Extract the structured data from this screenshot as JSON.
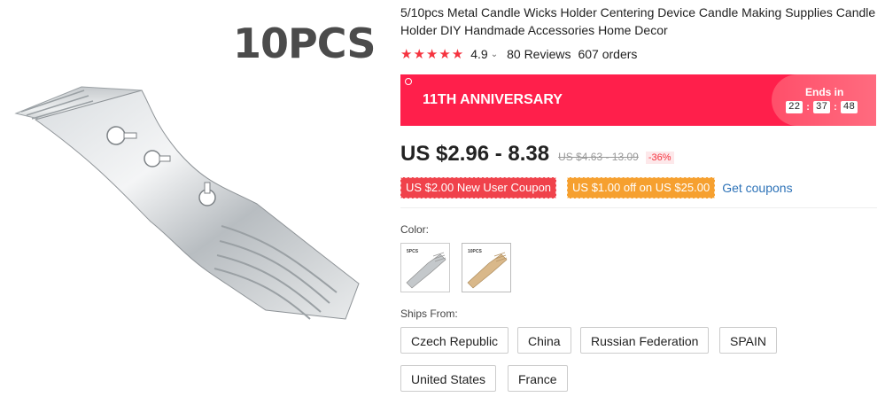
{
  "image_label": "10PCS",
  "product": {
    "title": "5/10pcs Metal Candle Wicks Holder Centering Device Candle Making Supplies Candle Holder DIY Handmade Accessories Home Decor",
    "stars": "★★★★★",
    "rating": "4.9",
    "reviews": "80 Reviews",
    "orders": "607 orders"
  },
  "banner": {
    "title": "11TH ANNIVERSARY",
    "ends_in": "Ends in",
    "timer": {
      "hours": "22",
      "minutes": "37",
      "seconds": "48"
    }
  },
  "price": {
    "current": "US $2.96 - 8.38",
    "original": "US $4.63 - 13.09",
    "discount": "-36%"
  },
  "coupons": {
    "new_user": "US $2.00 New User Coupon",
    "store": "US $1.00 off on US $25.00",
    "get_link": "Get coupons"
  },
  "color": {
    "label": "Color:",
    "options": [
      {
        "text": "5PCS"
      },
      {
        "text": "10PCS"
      }
    ]
  },
  "ships_from": {
    "label": "Ships From:",
    "options": [
      "Czech Republic",
      "China",
      "Russian Federation",
      "SPAIN",
      "United States",
      "France"
    ]
  },
  "colors": {
    "accent": "#ff1f4b",
    "star": "#f5333f",
    "coupon_red": "#f0424b",
    "coupon_orange": "#f6a02f",
    "link": "#2e73b8"
  }
}
